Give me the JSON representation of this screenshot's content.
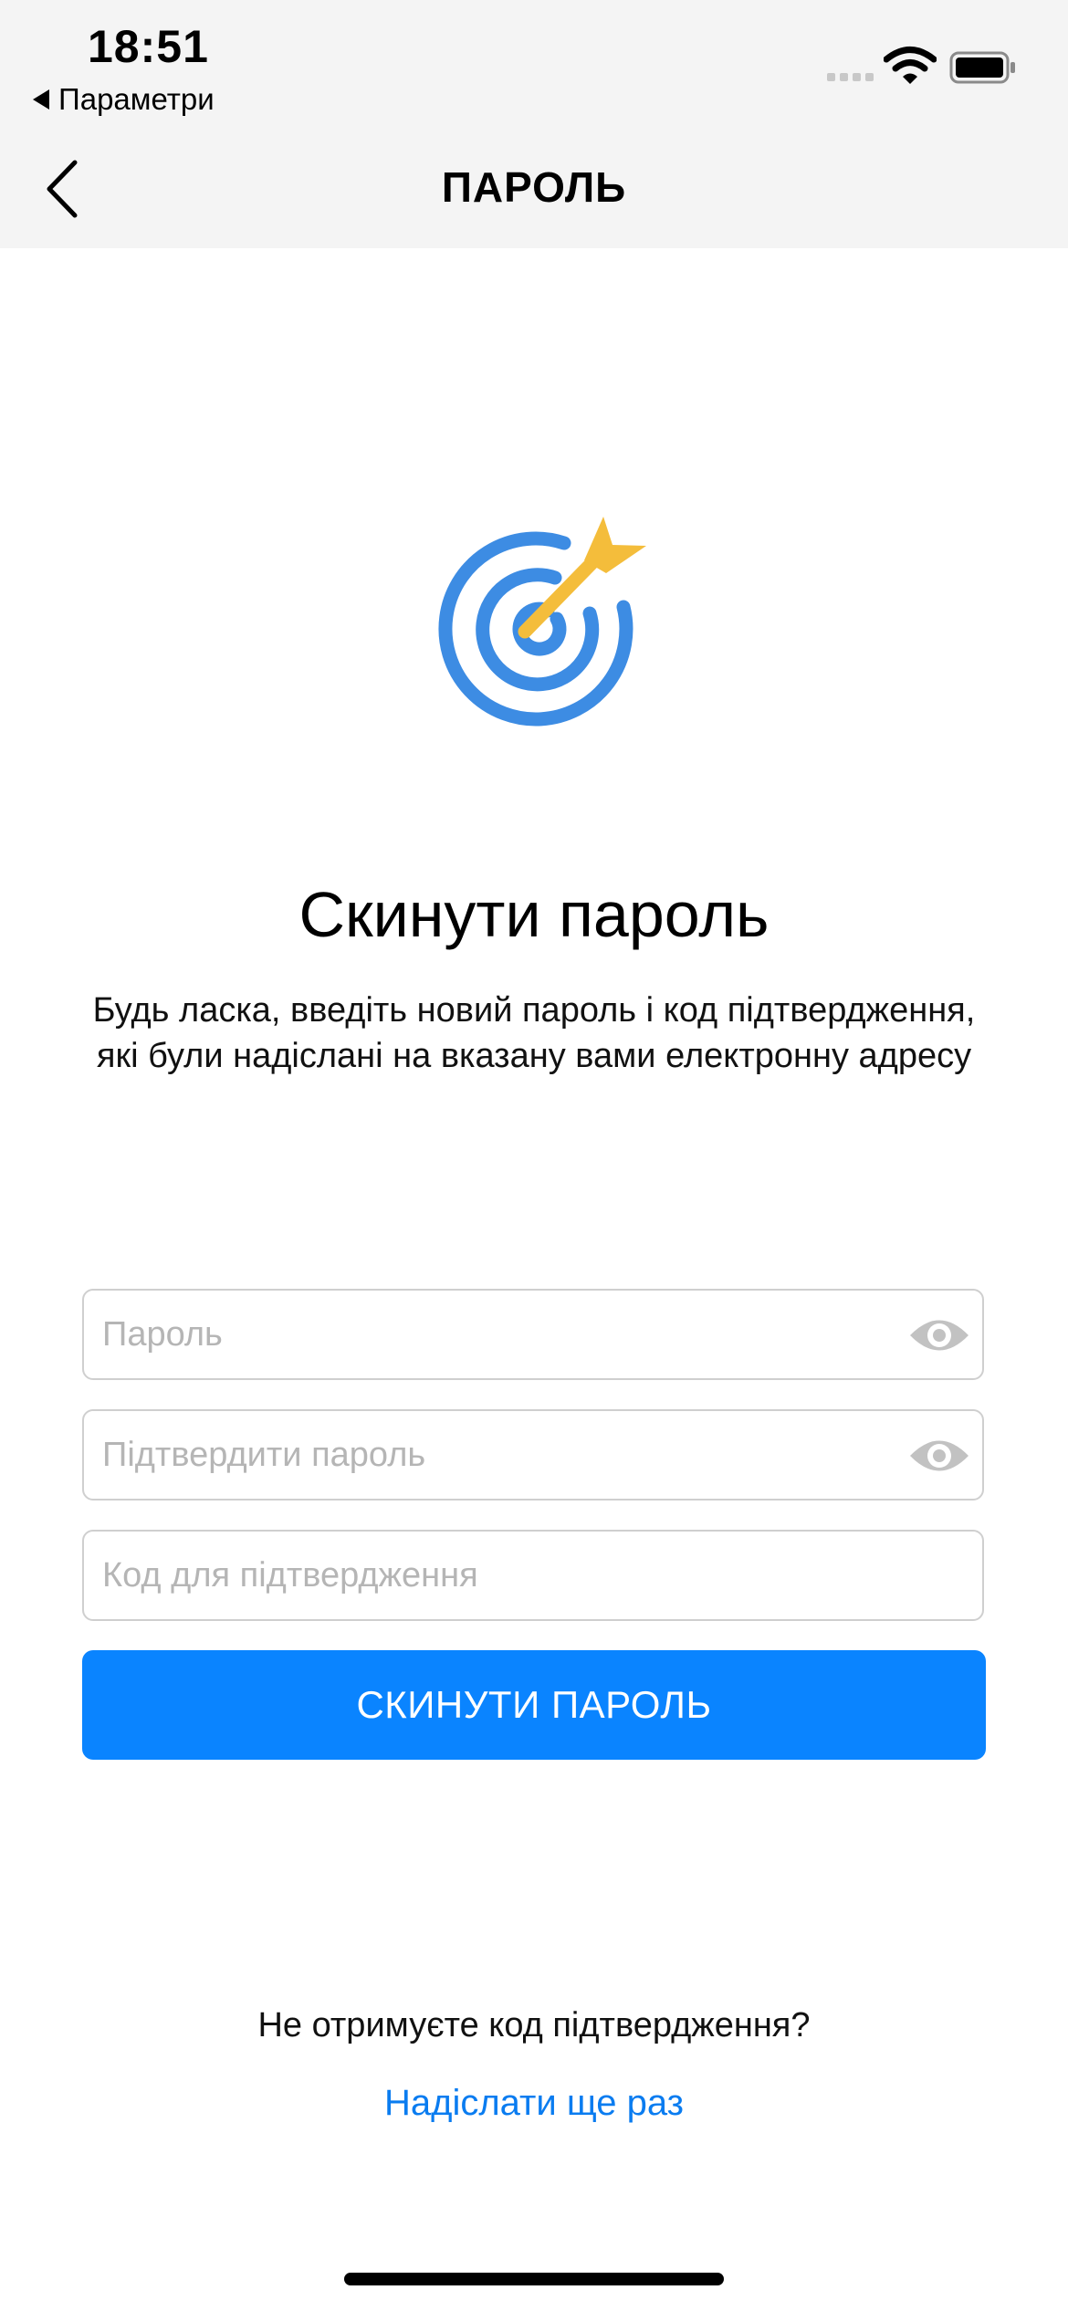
{
  "status_bar": {
    "time": "18:51",
    "back_app_label": "Параметри"
  },
  "nav": {
    "title": "ПАРОЛЬ"
  },
  "icons": {
    "nav_back": "chevron-left-icon",
    "target": "target-arrow-icon",
    "show_password": "eye-icon"
  },
  "main": {
    "title": "Скинути пароль",
    "description": "Будь ласка, введіть новий пароль і код підтвердження, які були надіслані на вказану вами електронну адресу"
  },
  "form": {
    "password": {
      "value": "",
      "placeholder": "Пароль"
    },
    "confirm_password": {
      "value": "",
      "placeholder": "Підтвердити пароль"
    },
    "code": {
      "value": "",
      "placeholder": "Код для підтвердження"
    },
    "submit_label": "СКИНУТИ ПАРОЛЬ"
  },
  "footer": {
    "question": "Не отримуєте код підтвердження?",
    "resend_label": "Надіслати ще раз"
  },
  "colors": {
    "accent": "#0a84ff",
    "link": "#0a7cf0",
    "target_blue": "#3d8ce3",
    "arrow_yellow": "#f4bd3b",
    "header_bg": "#f4f4f4"
  }
}
